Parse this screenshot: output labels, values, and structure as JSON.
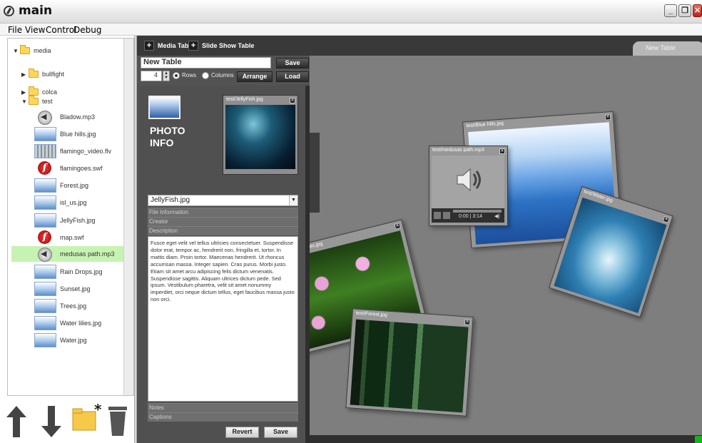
{
  "window": {
    "title": "main",
    "min_glyph": "_",
    "max_glyph": "❐",
    "close_glyph": "✕"
  },
  "menu": {
    "file": "File",
    "view": "View",
    "control": "Control",
    "debug": "Debug"
  },
  "tree": {
    "items": [
      {
        "label": "media",
        "type": "folder",
        "arrow": "▼"
      },
      {
        "label": "bullfight",
        "type": "folder",
        "arrow": "▶"
      },
      {
        "label": "colca",
        "type": "folder",
        "arrow": "▶"
      },
      {
        "label": "test",
        "type": "folder",
        "arrow": "▼"
      },
      {
        "label": "Bladow.mp3",
        "type": "audio"
      },
      {
        "label": "Blue hills.jpg",
        "type": "image"
      },
      {
        "label": "flamingo_video.flv",
        "type": "video"
      },
      {
        "label": "flamingoes.swf",
        "type": "flash"
      },
      {
        "label": "Forest.jpg",
        "type": "image"
      },
      {
        "label": "isl_us.jpg",
        "type": "image"
      },
      {
        "label": "JellyFish.jpg",
        "type": "image"
      },
      {
        "label": "map.swf",
        "type": "flash"
      },
      {
        "label": "medusas path.mp3",
        "type": "audio",
        "selected": true
      },
      {
        "label": "Rain Drops.jpg",
        "type": "image"
      },
      {
        "label": "Sunset.jpg",
        "type": "image"
      },
      {
        "label": "Trees.jpg",
        "type": "image"
      },
      {
        "label": "Water lilies.jpg",
        "type": "image"
      },
      {
        "label": "Water.jpg",
        "type": "image"
      }
    ]
  },
  "tools": {
    "up": "move-up",
    "down": "move-down",
    "new_folder": "new-folder",
    "trash": "delete"
  },
  "tabs": {
    "media_table": "Media Table",
    "slide_show_table": "Slide Show Table",
    "new_table": "New Table",
    "plus": "+"
  },
  "table_controls": {
    "name_value": "New Table",
    "save": "Save",
    "count_value": "4",
    "rows": "Rows",
    "columns": "Columns",
    "arrange": "Arrange",
    "load": "Load",
    "layout_selected": "rows"
  },
  "info": {
    "heading": "PHOTO INFO",
    "preview_title": "test/JellyFish.jpg",
    "selected_file": "JellyFish.jpg",
    "sections": {
      "file_information": "File Information",
      "creator": "Creator",
      "description": "Description",
      "notes": "Notes",
      "captions": "Captions"
    },
    "description_text": "Fusce eget velit vel tellus ultricies consectetuer. Suspendisse dolor erat, tempor ac, hendrerit non, fringilla et, tortor. In mattis diam. Proin tortor. Maecenas hendrerit. Ut rhoncus accumsan massa. Integer sapien. Cras purus. Morbi justo. Etiam sit amet arcu adipiscing felis dictum venenatis. Suspendisse sagittis. Aliquam ultrices dictum pede. Sed ipsum. Vestibulum pharetra, velit sit amet nonummy imperdiet, orci neque dictum tellus, eget faucibus massa justo non orci.",
    "revert": "Revert",
    "save": "Save"
  },
  "canvas_cards": {
    "blue_hills": "test/Blue hills.jpg",
    "water": "test/Water.jpg",
    "medusas": "test/medusas path.mp3",
    "lilies": "er lilies.jpg",
    "forest": "test/Forest.jpg",
    "audio_time": "0:00 | 3:14"
  }
}
